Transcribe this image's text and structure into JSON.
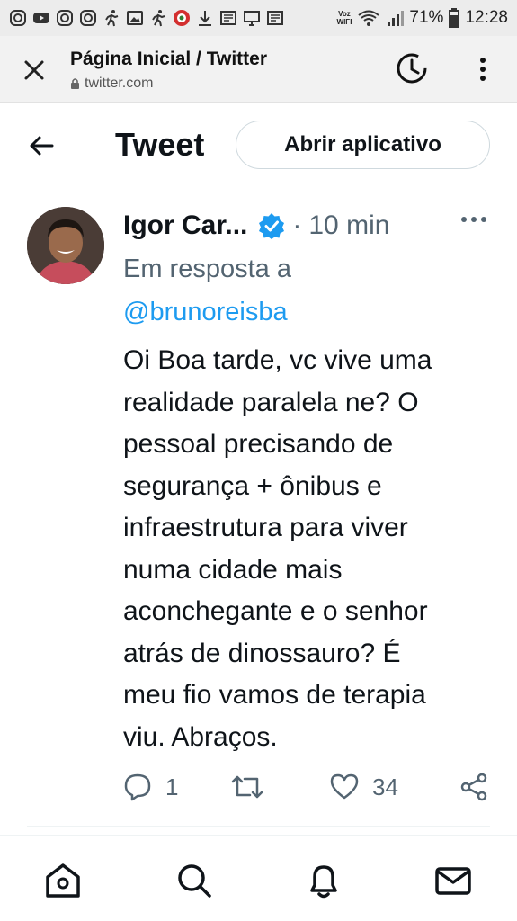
{
  "status_bar": {
    "voz_line1": "Voz",
    "voz_line2": "WIFI",
    "battery": "71%",
    "time": "12:28"
  },
  "browser": {
    "title": "Página Inicial / Twitter",
    "url": "twitter.com"
  },
  "header": {
    "title": "Tweet",
    "open_app_label": "Abrir aplicativo"
  },
  "tweet": {
    "author_name": "Igor Car...",
    "separator": "·",
    "time": "10 min",
    "reply_label": "Em resposta a",
    "reply_handle": "@brunoreisba",
    "text": "Oi Boa tarde, vc vive uma\nrealidade paralela ne? O\npessoal precisando de\nsegurança + ônibus e\ninfraestrutura para viver\nnuma cidade mais\naconchegante e o senhor\natrás de dinossauro? É\nmeu fio vamos de terapia\nviu. Abraços.",
    "replies": "1",
    "likes": "34"
  },
  "colors": {
    "accent": "#1d9bf0",
    "secondary_text": "#536471",
    "primary_text": "#0f1419"
  },
  "icons": {
    "nav": [
      "home-icon",
      "search-icon",
      "notifications-icon",
      "messages-icon"
    ]
  }
}
